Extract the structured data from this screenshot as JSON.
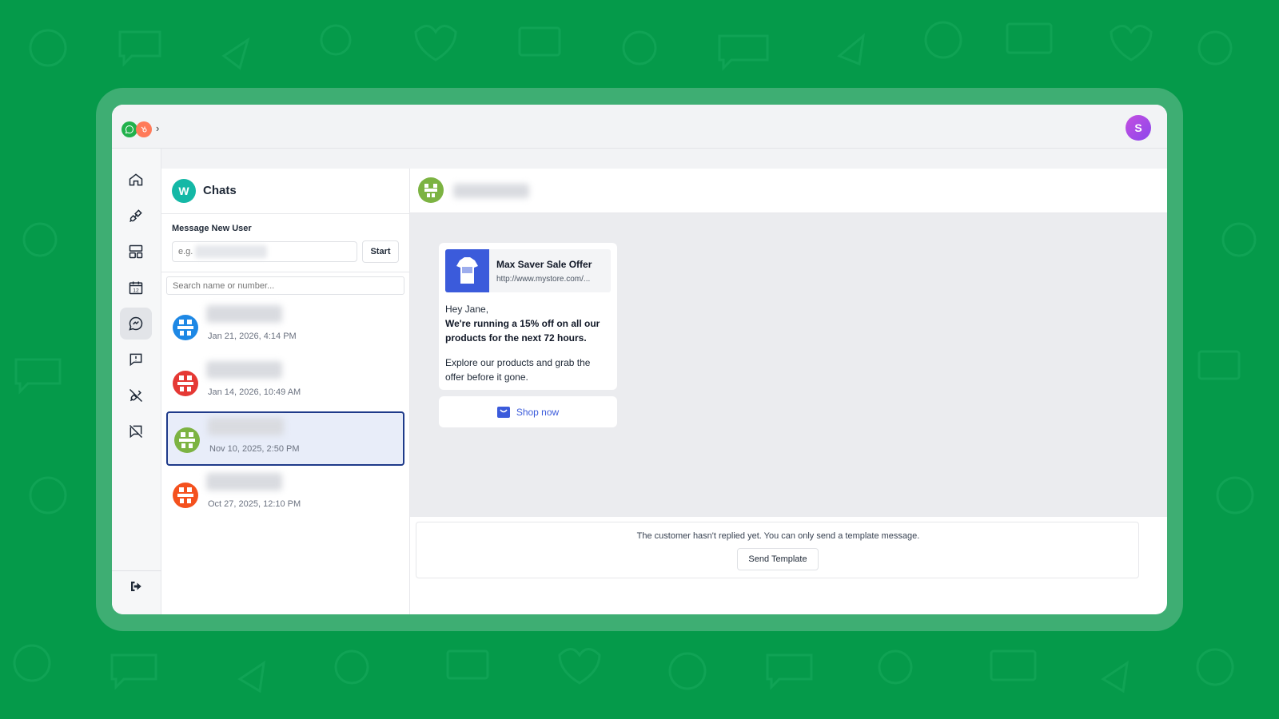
{
  "colors": {
    "background": "#059a4a",
    "frame": "#3eae73",
    "accent": "#3b5bdb",
    "selected_border": "#1e3a8a",
    "badge": "#14b8a6"
  },
  "topbar": {
    "logos": [
      "whatsapp-icon",
      "hubspot-icon"
    ],
    "avatar_initial": "S"
  },
  "sidebar": {
    "items": [
      {
        "name": "home-icon",
        "active": false
      },
      {
        "name": "plug-icon",
        "active": false
      },
      {
        "name": "templates-icon",
        "active": false
      },
      {
        "name": "calendar-icon",
        "active": false,
        "label": "12"
      },
      {
        "name": "chat-icon",
        "active": true
      },
      {
        "name": "alert-message-icon",
        "active": false
      },
      {
        "name": "disconnect-icon",
        "active": false
      },
      {
        "name": "message-off-icon",
        "active": false
      }
    ],
    "logout": "logout-icon"
  },
  "chats": {
    "badge": "W",
    "title": "Chats",
    "new_user_label": "Message New User",
    "new_user_placeholder": "e.g.",
    "start_label": "Start",
    "search_placeholder": "Search name or number...",
    "items": [
      {
        "date": "Jan 21, 2026, 4:14 PM",
        "avatar_color": "#1e88e5",
        "selected": false
      },
      {
        "date": "Jan 14, 2026, 10:49 AM",
        "avatar_color": "#e53935",
        "selected": false
      },
      {
        "date": "Nov 10, 2025, 2:50 PM",
        "avatar_color": "#7cb342",
        "selected": true
      },
      {
        "date": "Oct 27, 2025, 12:10 PM",
        "avatar_color": "#f4511e",
        "selected": false
      }
    ]
  },
  "conversation": {
    "avatar_color": "#7cb342",
    "message": {
      "preview_title": "Max Saver Sale Offer",
      "preview_url": "http://www.mystore.com/...",
      "greeting": "Hey Jane,",
      "bold_line1": "We're running a 15% off on all our",
      "bold_line2": "products for the next 72 hours.",
      "body_line1": "Explore our products and grab the",
      "body_line2": "offer before it gone."
    },
    "shop_button": "Shop now",
    "footer_note": "The customer hasn't replied yet. You can only send a template message.",
    "send_template": "Send Template"
  }
}
